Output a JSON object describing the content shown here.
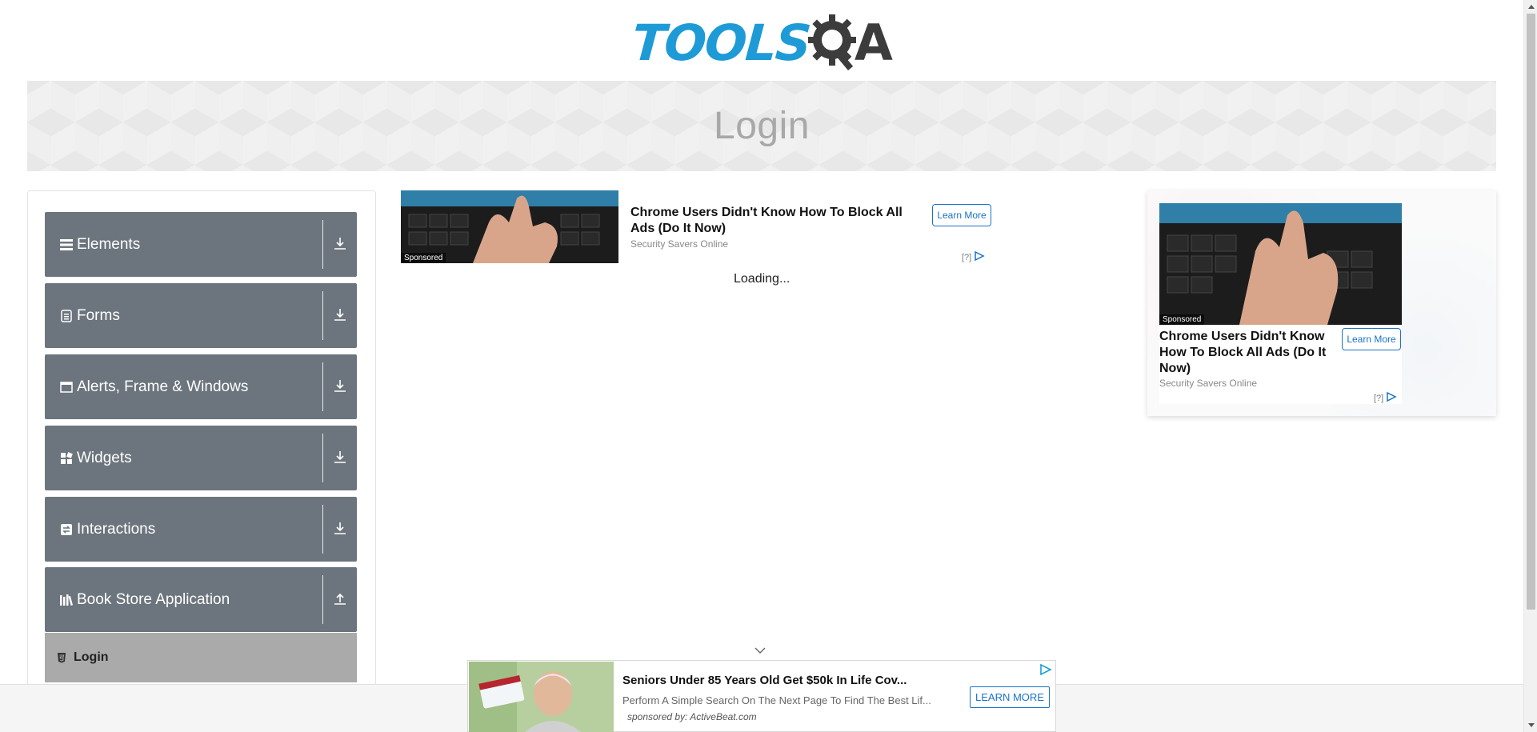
{
  "header": {
    "logo_text_blue": "TOOLS",
    "logo_text_dark": "A"
  },
  "banner": {
    "title": "Login"
  },
  "sidebar": {
    "groups": [
      {
        "label": "Elements",
        "icon": "hamburger-icon",
        "toggle": "chevron-down"
      },
      {
        "label": "Forms",
        "icon": "document-icon",
        "toggle": "chevron-down"
      },
      {
        "label": "Alerts, Frame & Windows",
        "icon": "window-icon",
        "toggle": "chevron-down"
      },
      {
        "label": "Widgets",
        "icon": "grid-icon",
        "toggle": "chevron-down"
      },
      {
        "label": "Interactions",
        "icon": "swap-icon",
        "toggle": "chevron-down"
      },
      {
        "label": "Book Store Application",
        "icon": "books-icon",
        "toggle": "chevron-up"
      }
    ],
    "active_item": {
      "label": "Login",
      "icon": "html-icon"
    }
  },
  "ad_top": {
    "sponsored": "Sponsored",
    "title": "Chrome Users Didn't Know How To Block All Ads (Do It Now)",
    "source": "Security Savers Online",
    "button": "Learn More",
    "adchoices": "[?]"
  },
  "main": {
    "loading": "Loading..."
  },
  "ad_right": {
    "sponsored": "Sponsored",
    "title": "Chrome Users Didn't Know How To Block All Ads (Do It Now)",
    "source": "Security Savers Online",
    "button": "Learn More",
    "adchoices": "[?]"
  },
  "ad_bottom": {
    "title": "Seniors Under 85 Years Old Get $50k In Life Cov...",
    "description": "Perform A Simple Search On The Next Page To Find The Best Lif...",
    "sponsor": "sponsored by: ActiveBeat.com",
    "button": "LEARN MORE"
  },
  "colors": {
    "logo_blue": "#1e9bd7",
    "sidebar_group_bg": "#6c757d",
    "sidebar_active_bg": "#aaaaaa",
    "ad_button": "#1a73c8"
  }
}
